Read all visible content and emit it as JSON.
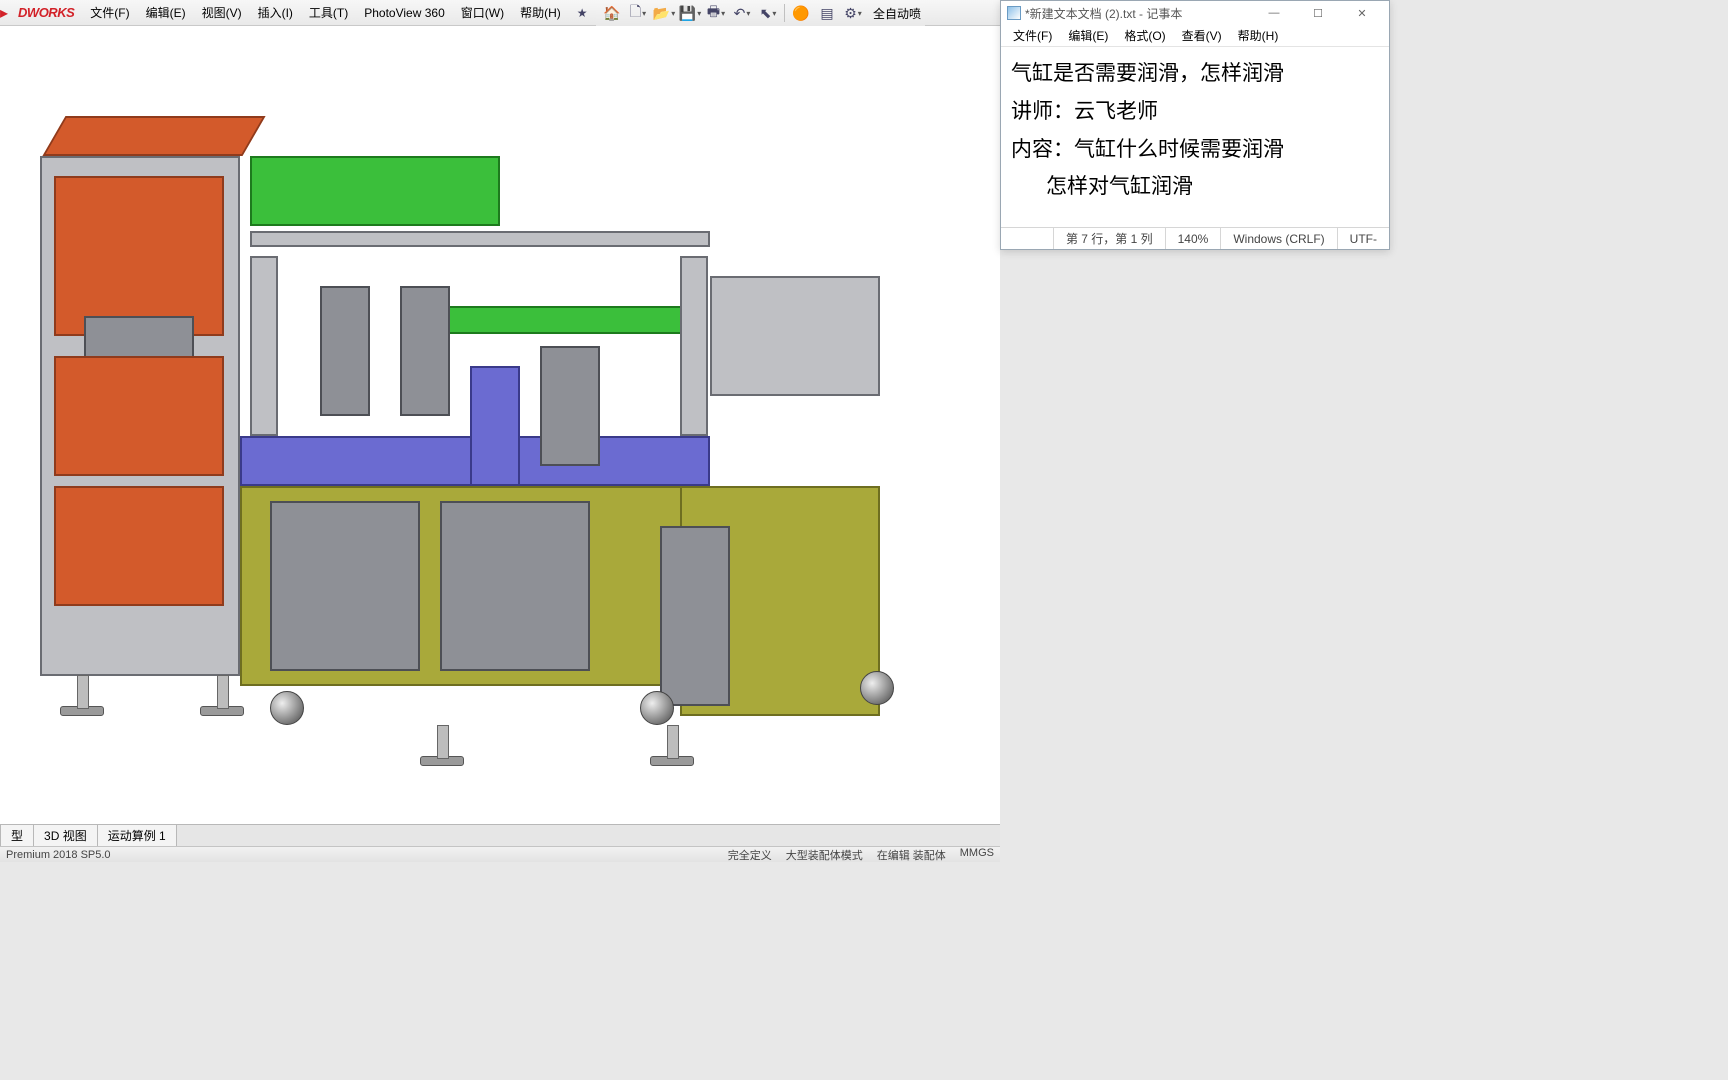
{
  "solidworks": {
    "logo": "DWORKS",
    "menu": [
      "文件(F)",
      "编辑(E)",
      "视图(V)",
      "插入(I)",
      "工具(T)",
      "PhotoView 360",
      "窗口(W)",
      "帮助(H)"
    ],
    "quickbar_doc_label": "全自动喷",
    "tabs": [
      "型",
      "3D 视图",
      "运动算例 1"
    ],
    "status_left": "Premium 2018 SP5.0",
    "status_right": [
      "完全定义",
      "大型装配体模式",
      "在编辑 装配体",
      "MMGS"
    ]
  },
  "notepad": {
    "title": "*新建文本文档 (2).txt - 记事本",
    "menu": [
      "文件(F)",
      "编辑(E)",
      "格式(O)",
      "查看(V)",
      "帮助(H)"
    ],
    "lines": [
      "气缸是否需要润滑，怎样润滑",
      "",
      "讲师：云飞老师",
      "",
      "内容：气缸什么时候需要润滑",
      "      怎样对气缸润滑"
    ],
    "status": {
      "pos": "第 7 行，第 1 列",
      "zoom": "140%",
      "eol": "Windows (CRLF)",
      "enc": "UTF-"
    }
  },
  "icons": {
    "home": "🏠",
    "new": "🗋",
    "open": "📂",
    "save": "💾",
    "print": "🖶",
    "undo": "↶",
    "arrow": "⬉",
    "rebuild": "🔄",
    "options": "⚙",
    "select": "✥",
    "zoomin": "🔍",
    "zoomfit": "🔎",
    "section": "✂",
    "viewcube": "◫",
    "ortho": "▦",
    "shaded": "◐",
    "appearance": "🎨",
    "scene": "🌐",
    "display": "🖵",
    "mag1": "🔍",
    "mag2": "🔎",
    "lasso": "➰",
    "box": "▭"
  }
}
